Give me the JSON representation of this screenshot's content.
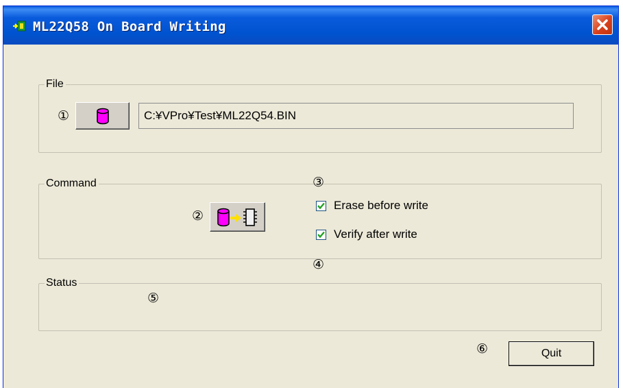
{
  "window": {
    "title": "ML22Q58 On Board Writing"
  },
  "file_group": {
    "label": "File",
    "marker": "①",
    "browse_icon": "database-icon",
    "path": "C:¥VPro¥Test¥ML22Q54.BIN"
  },
  "command_group": {
    "label": "Command",
    "write_marker": "②",
    "write_icon": "write-to-chip-icon",
    "checks_marker": "③",
    "checks_marker2": "④",
    "erase": {
      "label": "Erase before write",
      "checked": true
    },
    "verify": {
      "label": "Verify after write",
      "checked": true
    }
  },
  "status_group": {
    "label": "Status",
    "marker": "⑤",
    "text": ""
  },
  "footer": {
    "marker": "⑥",
    "quit_label": "Quit"
  },
  "colors": {
    "titlebar": "#0a5bdc",
    "dialog_bg": "#ece9d8",
    "cylinder": "#ff00ff",
    "arrow": "#ffff00"
  }
}
